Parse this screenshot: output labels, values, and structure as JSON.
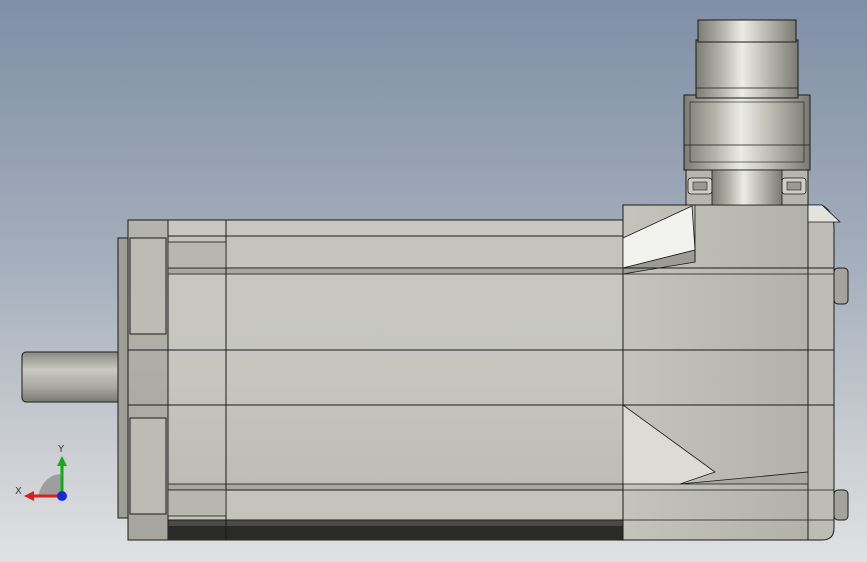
{
  "scene": {
    "model": "servo-motor-side-view"
  },
  "triad": {
    "x_label": "X",
    "y_label": "Y",
    "colors": {
      "x": "#d42020",
      "y": "#1aa81a",
      "z": "#1a2bd4"
    }
  },
  "colors": {
    "background_top": "#7f8fa6",
    "background_bottom": "#e0e1e2",
    "body": "#c6c6bf",
    "edge": "#1a1a1a"
  }
}
